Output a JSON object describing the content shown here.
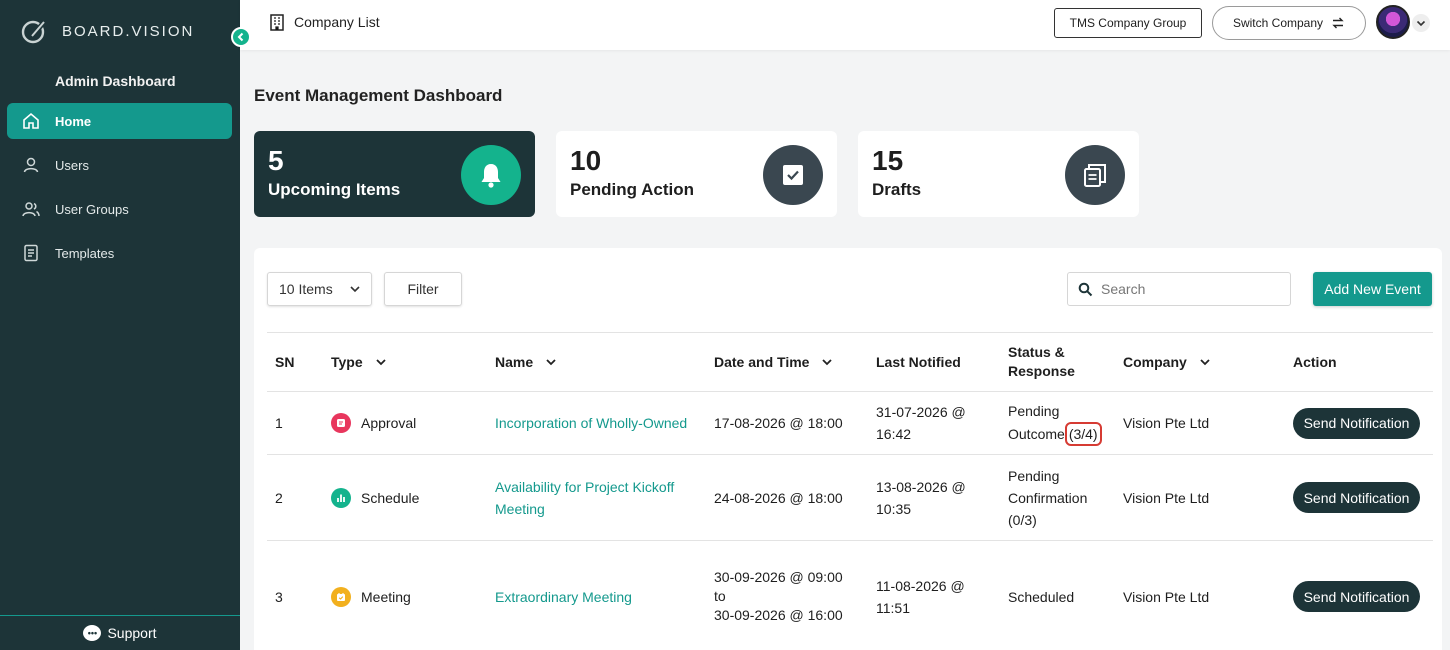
{
  "brand": {
    "name": "BOARD.VISION"
  },
  "sidebar": {
    "title": "Admin Dashboard",
    "items": [
      {
        "label": "Home",
        "icon": "home-icon",
        "active": true
      },
      {
        "label": "Users",
        "icon": "user-icon",
        "active": false
      },
      {
        "label": "User Groups",
        "icon": "users-icon",
        "active": false
      },
      {
        "label": "Templates",
        "icon": "document-icon",
        "active": false
      }
    ],
    "footer_label": "Support"
  },
  "topbar": {
    "breadcrumb": "Company List",
    "company_group": "TMS Company Group",
    "switch_company": "Switch Company"
  },
  "page": {
    "title": "Event Management Dashboard"
  },
  "cards": [
    {
      "count": "5",
      "label": "Upcoming Items",
      "icon": "bell-icon",
      "icon_color": "#14b38d"
    },
    {
      "count": "10",
      "label": "Pending Action",
      "icon": "checkbox-icon",
      "icon_color": "#3a4750"
    },
    {
      "count": "15",
      "label": "Drafts",
      "icon": "copy-icon",
      "icon_color": "#3a4750"
    }
  ],
  "toolbar": {
    "items_per_page": "10 Items",
    "filter_label": "Filter",
    "search_placeholder": "Search",
    "add_label": "Add New Event"
  },
  "table": {
    "headers": {
      "sn": "SN",
      "type": "Type",
      "name": "Name",
      "datetime": "Date and Time",
      "last_notified_line1": "Last Notified",
      "status_line1": "Status &",
      "status_line2": "Response",
      "company": "Company",
      "action": "Action"
    },
    "rows": [
      {
        "sn": "1",
        "type": "Approval",
        "type_color": "#e8365d",
        "name_line1": "Incorporation of Wholly-Owned",
        "name_line2": "",
        "dt_line1": "17-08-2026 @ 18:00",
        "dt_line2": "",
        "dt_line3": "",
        "ln_line1": "31-07-2026 @",
        "ln_line2": "16:42",
        "status_line1": "Pending",
        "status_line2": "Outcome",
        "status_response": "(3/4)",
        "status_line3": "",
        "company": "Vision Pte Ltd",
        "action": "Send Notification"
      },
      {
        "sn": "2",
        "type": "Schedule",
        "type_color": "#14b38d",
        "name_line1": "Availability for Project Kickoff",
        "name_line2": "Meeting",
        "dt_line1": "24-08-2026 @ 18:00",
        "dt_line2": "",
        "dt_line3": "",
        "ln_line1": "13-08-2026 @",
        "ln_line2": "10:35",
        "status_line1": "Pending",
        "status_line2": "Confirmation",
        "status_response": "",
        "status_line3": "(0/3)",
        "company": "Vision Pte Ltd",
        "action": "Send Notification"
      },
      {
        "sn": "3",
        "type": "Meeting",
        "type_color": "#f2b01e",
        "name_line1": "Extraordinary Meeting",
        "name_line2": "",
        "dt_line1": "30-09-2026 @ 09:00",
        "dt_line2": "to",
        "dt_line3": "30-09-2026 @ 16:00",
        "ln_line1": "11-08-2026 @",
        "ln_line2": "11:51",
        "status_line1": "Scheduled",
        "status_line2": "",
        "status_response": "",
        "status_line3": "",
        "company": "Vision Pte Ltd",
        "action": "Send Notification"
      }
    ]
  },
  "colors": {
    "sidebar_bg": "#1d3438",
    "accent": "#14998d",
    "highlight": "#d63b33"
  }
}
